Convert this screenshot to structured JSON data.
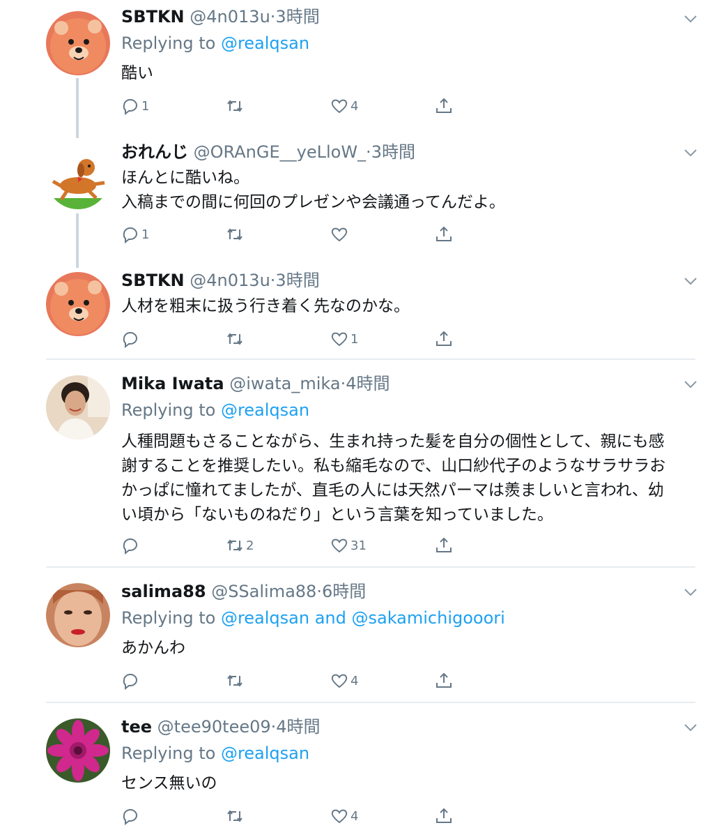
{
  "tweets": [
    {
      "name": "SBTKN",
      "handle": "@4n013u",
      "time": "3時間",
      "replying_prefix": "Replying to ",
      "replying_to": "@realqsan",
      "text": [
        "酷い"
      ],
      "reply_count": "1",
      "retweet_count": "",
      "like_count": "4",
      "avatar": "lion-plush-avatar"
    },
    {
      "name": "おれんじ",
      "handle": "@ORAnGE__yeLloW_",
      "time": "3時間",
      "text": [
        "ほんとに酷いね。",
        "入稿までの間に何回のプレゼンや会議通ってんだよ。"
      ],
      "reply_count": "1",
      "retweet_count": "",
      "like_count": "",
      "avatar": "dog-illustration-avatar"
    },
    {
      "name": "SBTKN",
      "handle": "@4n013u",
      "time": "3時間",
      "text": [
        "人材を粗末に扱う行き着く先なのかな。"
      ],
      "reply_count": "",
      "retweet_count": "",
      "like_count": "1",
      "avatar": "lion-plush-avatar"
    },
    {
      "name": "Mika Iwata",
      "handle": "@iwata_mika",
      "time": "4時間",
      "replying_prefix": "Replying to ",
      "replying_to": "@realqsan",
      "text": [
        "人種問題もさることながら、生まれ持った髪を自分の個性として、親にも感",
        "謝することを推奨したい。私も縮毛なので、山口紗代子のようなサラサラお",
        "かっぱに憧れてましたが、直毛の人には天然パーマは羨ましいと言われ、幼",
        "い頃から「ないものねだり」という言葉を知っていました。"
      ],
      "reply_count": "",
      "retweet_count": "2",
      "like_count": "31",
      "avatar": "woman-photo-avatar"
    },
    {
      "name": "salima88",
      "handle": "@SSalima88",
      "time": "6時間",
      "replying_prefix": "Replying to ",
      "replying_to": "@realqsan and @sakamichigooori",
      "text": [
        "あかんわ"
      ],
      "reply_count": "",
      "retweet_count": "",
      "like_count": "4",
      "avatar": "woman-closeup-avatar"
    },
    {
      "name": "tee",
      "handle": "@tee90tee09",
      "time": "4時間",
      "replying_prefix": "Replying to ",
      "replying_to": "@realqsan",
      "text": [
        "センス無いの"
      ],
      "reply_count": "",
      "retweet_count": "",
      "like_count": "4",
      "avatar": "pink-flower-avatar"
    }
  ],
  "separator": "·",
  "icons": {
    "reply": "reply-icon",
    "retweet": "retweet-icon",
    "like": "heart-icon",
    "share": "share-icon",
    "more": "chevron-down-icon"
  },
  "colors": {
    "link": "#1da1f2",
    "secondary": "#657786",
    "divider": "#e6ecf0",
    "thread": "#ccd6dd"
  }
}
